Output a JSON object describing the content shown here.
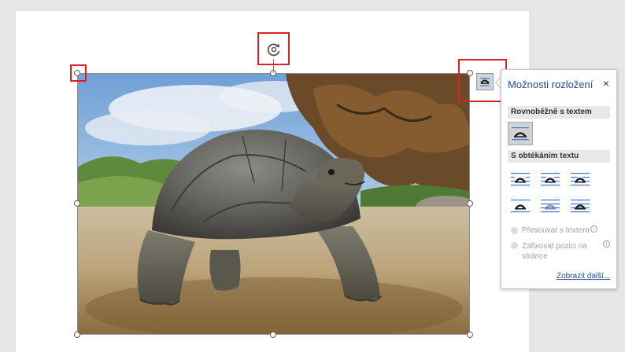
{
  "panel": {
    "title": "Možnosti rozložení",
    "close_icon": "×",
    "inline_header": "Rovnoběžně s textem",
    "wrap_header": "S obtékáním textu",
    "move_with_text": "Přesouvat s textem",
    "fix_position_line1": "Zafixovat pozici na",
    "fix_position_line2": "stránce",
    "see_more": "Zobrazit další..."
  },
  "icons": {
    "rotate": "rotate-icon",
    "layout_options": "layout-options-icon"
  },
  "colors": {
    "accent": "#1f4e9c",
    "highlight": "#e02020",
    "wrap_icon_blue": "#3c78d8"
  }
}
